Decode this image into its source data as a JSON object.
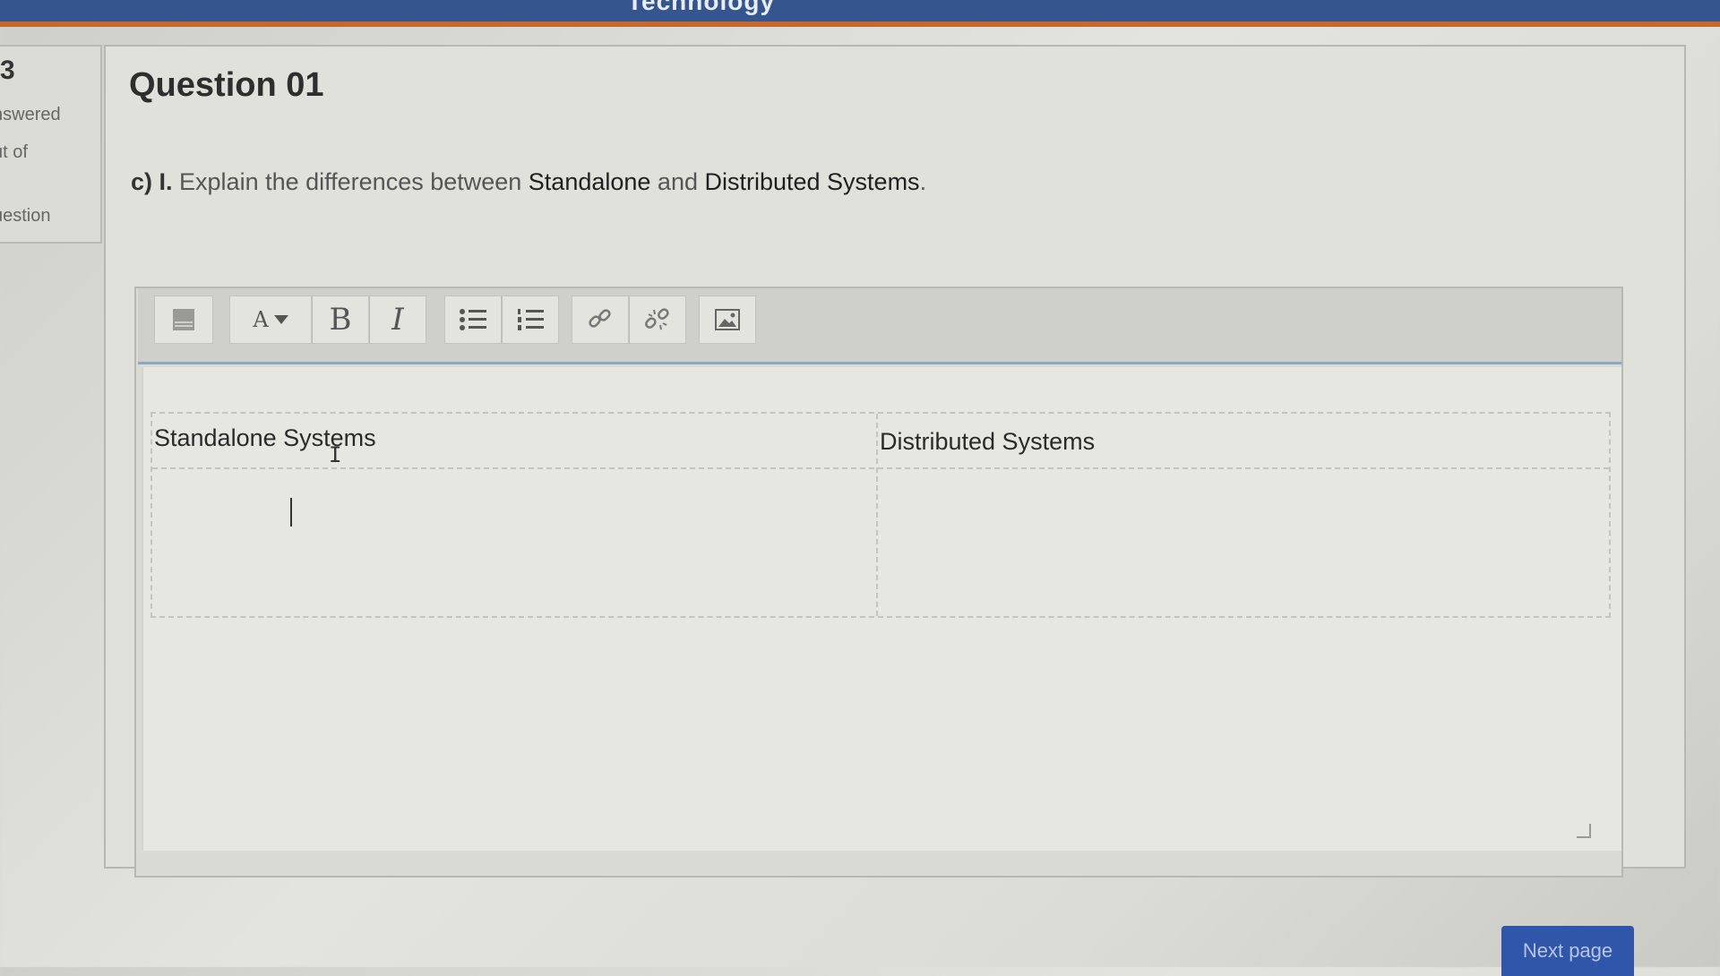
{
  "header": {
    "title": "Technology"
  },
  "info_panel": {
    "number": "3",
    "status": "nswered",
    "marks": "ut of",
    "flag": "uestion"
  },
  "question": {
    "title": "Question 01",
    "label": "c) I.",
    "text_before": "Explain the differences between ",
    "term1": "Standalone",
    "text_mid": " and ",
    "term2": "Distributed Systems",
    "text_end": "."
  },
  "toolbar": {
    "icons": [
      "toolbar-toggle-icon",
      "font-size-icon",
      "bold-icon",
      "italic-icon",
      "unordered-list-icon",
      "ordered-list-icon",
      "link-icon",
      "unlink-icon",
      "image-icon"
    ],
    "font_size_glyph": "A",
    "bold_glyph": "B",
    "italic_glyph": "I"
  },
  "answer_table": {
    "col1_header": "Standalone Systems",
    "col2_header": "Distributed Systems",
    "col1_value": "",
    "col2_value": ""
  },
  "navigation": {
    "next_label": "Next page"
  }
}
